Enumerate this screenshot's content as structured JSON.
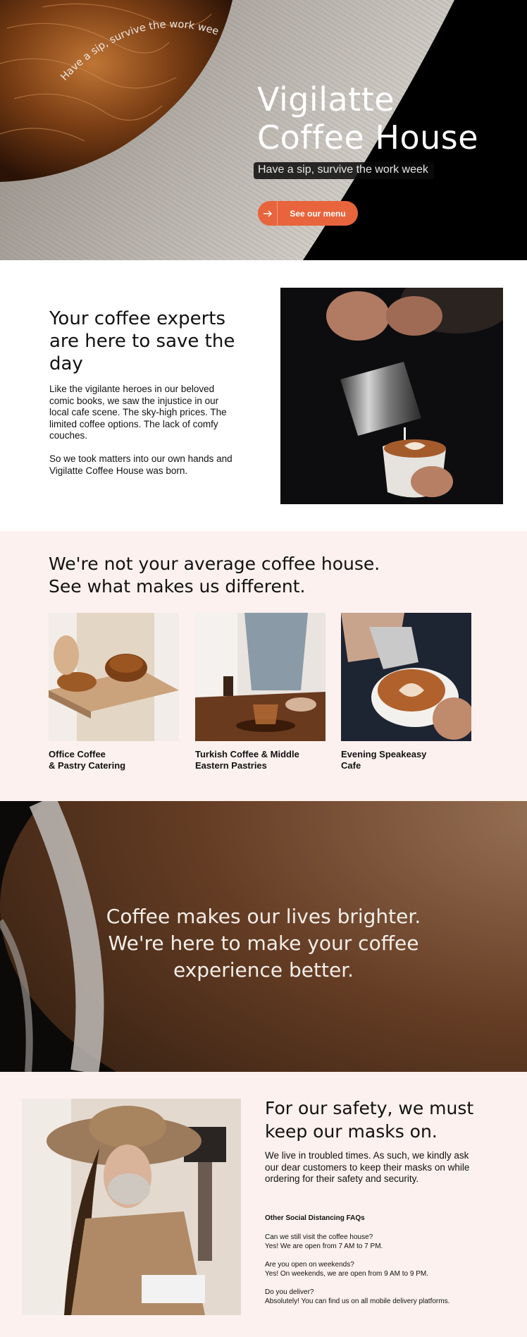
{
  "hero": {
    "curved_text": "Have a sip, survive the work week",
    "title_line1": "Vigilatte",
    "title_line2": "Coffee House",
    "tagline": "Have a sip, survive the work week",
    "cta_label": "See our menu",
    "cta_icon": "arrow-right-icon",
    "accent_color": "#e8643c"
  },
  "experts": {
    "heading": "Your coffee experts are here to save the day",
    "paragraph1": "Like the vigilante heroes in our beloved comic books, we saw the injustice in our local cafe scene. The sky-high prices. The limited coffee options. The lack of comfy couches.",
    "paragraph2": "So we took matters into our own hands and Vigilatte Coffee House was born."
  },
  "different": {
    "heading_line1": "We're not your average coffee house.",
    "heading_line2": "See what makes us different.",
    "background": "#fcf1ee",
    "cards": [
      {
        "line1": "Office Coffee",
        "line2": "& Pastry Catering"
      },
      {
        "line1": "Turkish Coffee & Middle",
        "line2": "Eastern Pastries"
      },
      {
        "line1": "Evening Speakeasy",
        "line2": "Cafe"
      }
    ]
  },
  "brighter": {
    "line1": "Coffee makes our lives brighter.",
    "line2": "We're here to make your coffee",
    "line3": "experience better."
  },
  "safety": {
    "heading": "For our safety, we must keep our masks on.",
    "paragraph": "We live in troubled times. As such, we kindly ask our dear customers to keep their masks on while ordering for their safety and security.",
    "faq_title": "Other Social Distancing FAQs",
    "faqs": [
      {
        "q": "Can we still visit the coffee house?",
        "a": "Yes! We are open from 7 AM to 7 PM."
      },
      {
        "q": "Are you open on weekends?",
        "a": "Yes! On weekends, we are open from 9 AM to 9 PM."
      },
      {
        "q": "Do you deliver?",
        "a": "Absolutely! You can find us on all mobile delivery platforms."
      }
    ]
  }
}
